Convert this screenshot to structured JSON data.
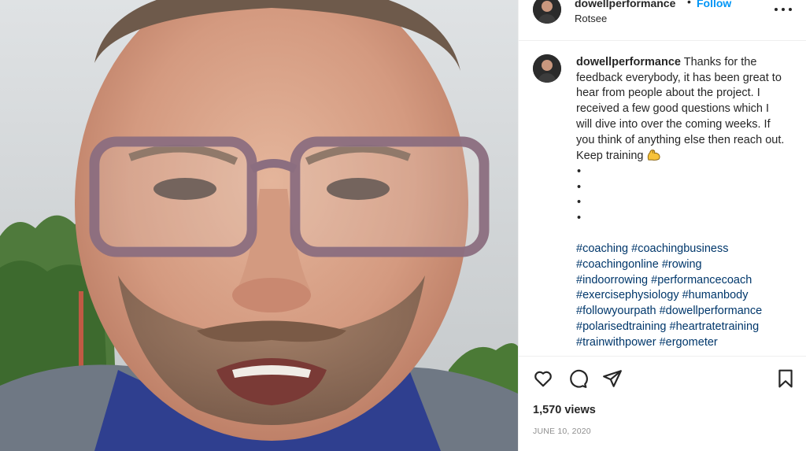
{
  "header": {
    "username": "dowellperformance",
    "separator": "•",
    "follow_label": "Follow",
    "location": "Rotsee",
    "more_icon": "more-horizontal-icon"
  },
  "caption": {
    "username": "dowellperformance",
    "text": "Thanks for the feedback everybody, it has been great to hear from people about the project. I received a few good questions which I will dive into over the coming weeks. If you think of anything else then reach out. Keep training",
    "emoji_icon": "flexed-biceps-icon",
    "bullets": [
      "•",
      "•",
      "•",
      "•"
    ],
    "hashtags": [
      "#coaching",
      "#coachingbusiness",
      "#coachingonline",
      "#rowing",
      "#indoorrowing",
      "#performancecoach",
      "#exercisephysiology",
      "#humanbody",
      "#followyourpath",
      "#dowellperformance",
      "#polarisedtraining",
      "#heartratetraining",
      "#trainwithpower",
      "#ergometer"
    ]
  },
  "actions": {
    "like_icon": "heart-icon",
    "comment_icon": "comment-icon",
    "share_icon": "share-icon",
    "save_icon": "bookmark-icon"
  },
  "stats": {
    "views": "1,570 views",
    "date": "JUNE 10, 2020"
  },
  "colors": {
    "link_blue": "#0095f6",
    "hashtag_blue": "#00376b",
    "text": "#262626",
    "muted": "#8e8e8e",
    "divider": "#efefef"
  }
}
